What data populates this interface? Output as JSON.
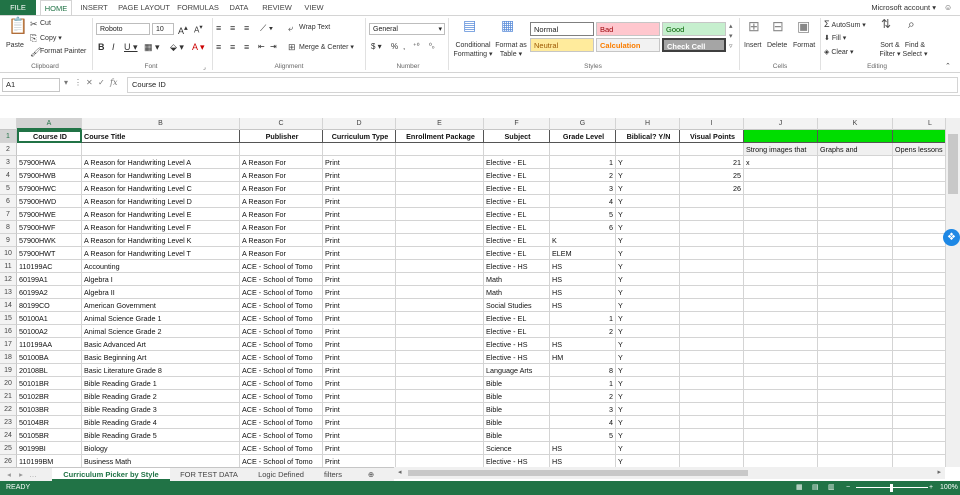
{
  "ribbon_tabs": [
    "FILE",
    "HOME",
    "INSERT",
    "PAGE LAYOUT",
    "FORMULAS",
    "DATA",
    "REVIEW",
    "VIEW"
  ],
  "account": "Microsoft account",
  "clipboard": {
    "paste": "Paste",
    "cut": "Cut",
    "copy": "Copy",
    "format_painter": "Format Painter",
    "label": "Clipboard"
  },
  "font": {
    "name": "Roboto",
    "size": "10",
    "label": "Font"
  },
  "alignment": {
    "wrap_text": "Wrap Text",
    "merge_center": "Merge & Center",
    "label": "Alignment"
  },
  "number": {
    "format": "General",
    "label": "Number"
  },
  "styles": {
    "conditional": "Conditional Formatting",
    "format_as_table": "Format as Table",
    "normal": "Normal",
    "bad": "Bad",
    "good": "Good",
    "neutral": "Neutral",
    "calculation": "Calculation",
    "check_cell": "Check Cell",
    "label": "Styles"
  },
  "cells_group": {
    "insert": "Insert",
    "delete": "Delete",
    "format": "Format",
    "label": "Cells"
  },
  "editing": {
    "autosum": "AutoSum",
    "fill": "Fill",
    "clear": "Clear",
    "sort_filter": "Sort & Filter",
    "find_select": "Find & Select",
    "label": "Editing"
  },
  "formula_bar": {
    "name_box": "A1",
    "content": "Course ID"
  },
  "columns": [
    "A",
    "B",
    "C",
    "D",
    "E",
    "F",
    "G",
    "H",
    "I",
    "J",
    "K",
    "L"
  ],
  "header_row": [
    "Course ID",
    "Course Title",
    "Publisher",
    "Curriculum Type",
    "Enrollment Package",
    "Subject",
    "Grade Level",
    "Biblical? Y/N",
    "Visual Points",
    "",
    "",
    ""
  ],
  "row2": [
    "",
    "",
    "",
    "",
    "",
    "",
    "",
    "",
    "",
    "Strong images that",
    "Graphs and",
    "Opens lessons"
  ],
  "rows": [
    [
      "57900HWA",
      "A Reason for Handwriting Level A",
      "A Reason For",
      "Print",
      "",
      "Elective - EL",
      "1",
      "Y",
      "21",
      "x",
      "",
      ""
    ],
    [
      "57900HWB",
      "A Reason for Handwriting Level B",
      "A Reason For",
      "Print",
      "",
      "Elective - EL",
      "2",
      "Y",
      "25",
      "",
      "",
      ""
    ],
    [
      "57900HWC",
      "A Reason for Handwriting Level C",
      "A Reason For",
      "Print",
      "",
      "Elective - EL",
      "3",
      "Y",
      "26",
      "",
      "",
      ""
    ],
    [
      "57900HWD",
      "A Reason for Handwriting Level D",
      "A Reason For",
      "Print",
      "",
      "Elective - EL",
      "4",
      "Y",
      "",
      "",
      "",
      ""
    ],
    [
      "57900HWE",
      "A Reason for Handwriting Level E",
      "A Reason For",
      "Print",
      "",
      "Elective - EL",
      "5",
      "Y",
      "",
      "",
      "",
      ""
    ],
    [
      "57900HWF",
      "A Reason for Handwriting Level F",
      "A Reason For",
      "Print",
      "",
      "Elective - EL",
      "6",
      "Y",
      "",
      "",
      "",
      ""
    ],
    [
      "57900HWK",
      "A Reason for Handwriting Level K",
      "A Reason For",
      "Print",
      "",
      "Elective - EL",
      "K",
      "Y",
      "",
      "",
      "",
      ""
    ],
    [
      "57900HWT",
      "A Reason for Handwriting Level T",
      "A Reason For",
      "Print",
      "",
      "Elective - EL",
      "ELEM",
      "Y",
      "",
      "",
      "",
      ""
    ],
    [
      "110199AC",
      "Accounting",
      "ACE - School of Tomo",
      "Print",
      "",
      "Elective - HS",
      "HS",
      "Y",
      "",
      "",
      "",
      ""
    ],
    [
      "60199A1",
      "Algebra I",
      "ACE - School of Tomo",
      "Print",
      "",
      "Math",
      "HS",
      "Y",
      "",
      "",
      "",
      ""
    ],
    [
      "60199A2",
      "Algebra II",
      "ACE - School of Tomo",
      "Print",
      "",
      "Math",
      "HS",
      "Y",
      "",
      "",
      "",
      ""
    ],
    [
      "80199CO",
      "American Government",
      "ACE - School of Tomo",
      "Print",
      "",
      "Social Studies",
      "HS",
      "Y",
      "",
      "",
      "",
      ""
    ],
    [
      "50100A1",
      "Animal Science Grade 1",
      "ACE - School of Tomo",
      "Print",
      "",
      "Elective - EL",
      "1",
      "Y",
      "",
      "",
      "",
      ""
    ],
    [
      "50100A2",
      "Animal Science Grade 2",
      "ACE - School of Tomo",
      "Print",
      "",
      "Elective - EL",
      "2",
      "Y",
      "",
      "",
      "",
      ""
    ],
    [
      "110199AA",
      "Basic Advanced Art",
      "ACE - School of Tomo",
      "Print",
      "",
      "Elective - HS",
      "HS",
      "Y",
      "",
      "",
      "",
      ""
    ],
    [
      "50100BA",
      "Basic Beginning Art",
      "ACE - School of Tomo",
      "Print",
      "",
      "Elective - HS",
      "HM",
      "Y",
      "",
      "",
      "",
      ""
    ],
    [
      "20108BL",
      "Basic Literature Grade 8",
      "ACE - School of Tomo",
      "Print",
      "",
      "Language Arts",
      "8",
      "Y",
      "",
      "",
      "",
      ""
    ],
    [
      "50101BR",
      "Bible Reading Grade 1",
      "ACE - School of Tomo",
      "Print",
      "",
      "Bible",
      "1",
      "Y",
      "",
      "",
      "",
      ""
    ],
    [
      "50102BR",
      "Bible Reading Grade 2",
      "ACE - School of Tomo",
      "Print",
      "",
      "Bible",
      "2",
      "Y",
      "",
      "",
      "",
      ""
    ],
    [
      "50103BR",
      "Bible Reading Grade 3",
      "ACE - School of Tomo",
      "Print",
      "",
      "Bible",
      "3",
      "Y",
      "",
      "",
      "",
      ""
    ],
    [
      "50104BR",
      "Bible Reading Grade 4",
      "ACE - School of Tomo",
      "Print",
      "",
      "Bible",
      "4",
      "Y",
      "",
      "",
      "",
      ""
    ],
    [
      "50105BR",
      "Bible Reading Grade 5",
      "ACE - School of Tomo",
      "Print",
      "",
      "Bible",
      "5",
      "Y",
      "",
      "",
      "",
      ""
    ],
    [
      "90199BI",
      "Biology",
      "ACE - School of Tomo",
      "Print",
      "",
      "Science",
      "HS",
      "Y",
      "",
      "",
      "",
      ""
    ],
    [
      "110199BM",
      "Business Math",
      "ACE - School of Tomo",
      "Print",
      "",
      "Elective - HS",
      "HS",
      "Y",
      "",
      "",
      "",
      ""
    ]
  ],
  "sheet_tabs": [
    "Curriculum Picker by Style",
    "FOR TEST DATA",
    "Logic Defined",
    "filters"
  ],
  "status": {
    "ready": "READY",
    "zoom": "100%"
  },
  "colors": {
    "accent": "#217346",
    "header_fill": "#00dd00"
  }
}
